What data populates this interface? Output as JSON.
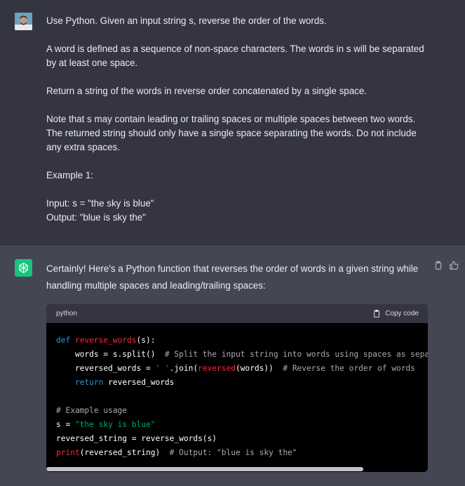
{
  "user_message": {
    "paragraphs": [
      "Use Python. Given an input string s, reverse the order of the words.",
      "A word is defined as a sequence of non-space characters. The words in s will be separated by at least one space.",
      "Return a string of the words in reverse order concatenated by a single space.",
      "Note that s may contain leading or trailing spaces or multiple spaces between two words. The returned string should only have a single space separating the words. Do not include any extra spaces.",
      "Example 1:",
      "Input: s = \"the sky is blue\"",
      "Output: \"blue is sky the\""
    ]
  },
  "assistant_message": {
    "intro": "Certainly! Here's a Python function that reverses the order of words in a given string while handling multiple spaces and leading/trailing spaces:",
    "code_block": {
      "language": "python",
      "copy_label": "Copy code",
      "lines": [
        [
          [
            "kw",
            "def "
          ],
          [
            "fn",
            "reverse_words"
          ],
          [
            "t",
            "(s):"
          ]
        ],
        [
          [
            "t",
            "    words = s.split()  "
          ],
          [
            "cm",
            "# Split the input string into words using spaces as separator"
          ]
        ],
        [
          [
            "t",
            "    reversed_words = "
          ],
          [
            "str",
            "' '"
          ],
          [
            "t",
            ".join("
          ],
          [
            "fn",
            "reversed"
          ],
          [
            "t",
            "(words))  "
          ],
          [
            "cm",
            "# Reverse the order of words"
          ]
        ],
        [
          [
            "t",
            "    "
          ],
          [
            "kw",
            "return"
          ],
          [
            "t",
            " reversed_words"
          ]
        ],
        [
          [
            "t",
            ""
          ]
        ],
        [
          [
            "cm",
            "# Example usage"
          ]
        ],
        [
          [
            "t",
            "s = "
          ],
          [
            "str",
            "\"the sky is blue\""
          ]
        ],
        [
          [
            "t",
            "reversed_string = reverse_words(s)"
          ]
        ],
        [
          [
            "fn",
            "print"
          ],
          [
            "t",
            "(reversed_string)  "
          ],
          [
            "cm",
            "# Output: \"blue is sky the\""
          ]
        ]
      ]
    }
  },
  "icons": {
    "copy_message": "clipboard-icon",
    "thumbs_up": "thumbs-up-icon",
    "assistant_avatar": "openai-logo-icon"
  },
  "colors": {
    "user_bg": "#343541",
    "assistant_bg": "#444654",
    "avatar_green": "#19c37d",
    "keyword": "#2e95d3",
    "function": "#f22c3d",
    "string": "#00a67d",
    "comment": "#a9a9a9"
  }
}
